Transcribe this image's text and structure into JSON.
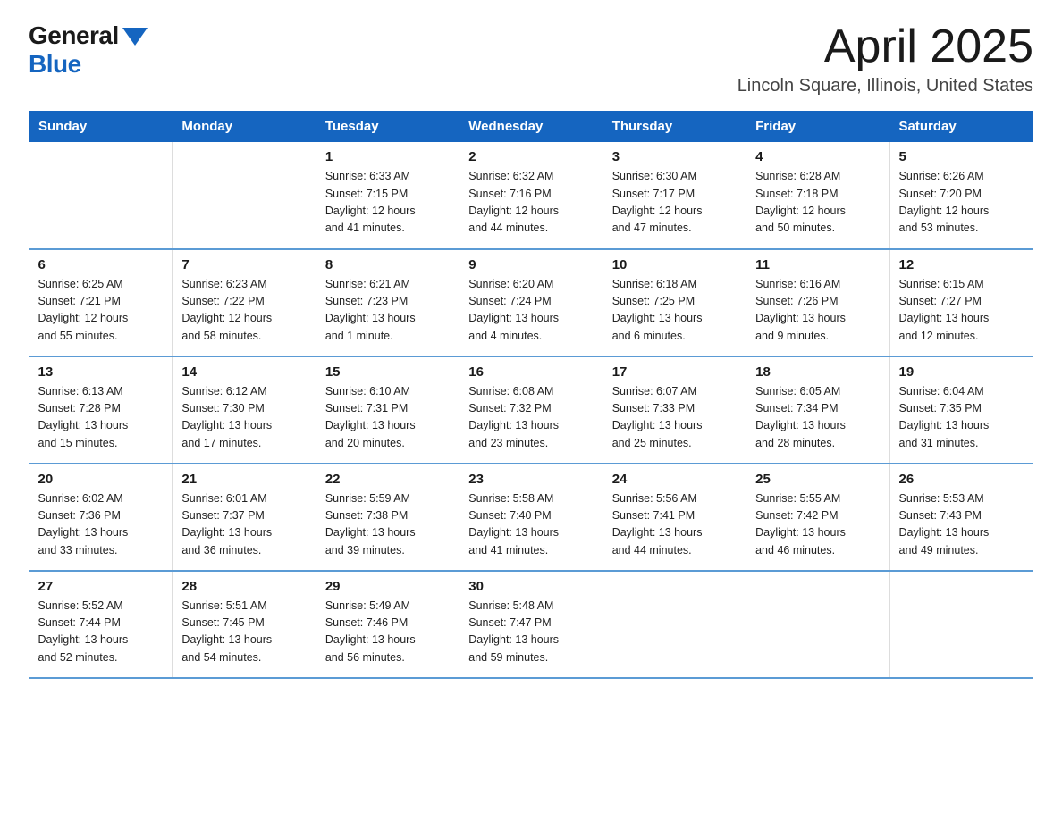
{
  "header": {
    "logo_general": "General",
    "logo_blue": "Blue",
    "title": "April 2025",
    "subtitle": "Lincoln Square, Illinois, United States"
  },
  "days_of_week": [
    "Sunday",
    "Monday",
    "Tuesday",
    "Wednesday",
    "Thursday",
    "Friday",
    "Saturday"
  ],
  "weeks": [
    [
      {
        "day": "",
        "info": ""
      },
      {
        "day": "",
        "info": ""
      },
      {
        "day": "1",
        "info": "Sunrise: 6:33 AM\nSunset: 7:15 PM\nDaylight: 12 hours\nand 41 minutes."
      },
      {
        "day": "2",
        "info": "Sunrise: 6:32 AM\nSunset: 7:16 PM\nDaylight: 12 hours\nand 44 minutes."
      },
      {
        "day": "3",
        "info": "Sunrise: 6:30 AM\nSunset: 7:17 PM\nDaylight: 12 hours\nand 47 minutes."
      },
      {
        "day": "4",
        "info": "Sunrise: 6:28 AM\nSunset: 7:18 PM\nDaylight: 12 hours\nand 50 minutes."
      },
      {
        "day": "5",
        "info": "Sunrise: 6:26 AM\nSunset: 7:20 PM\nDaylight: 12 hours\nand 53 minutes."
      }
    ],
    [
      {
        "day": "6",
        "info": "Sunrise: 6:25 AM\nSunset: 7:21 PM\nDaylight: 12 hours\nand 55 minutes."
      },
      {
        "day": "7",
        "info": "Sunrise: 6:23 AM\nSunset: 7:22 PM\nDaylight: 12 hours\nand 58 minutes."
      },
      {
        "day": "8",
        "info": "Sunrise: 6:21 AM\nSunset: 7:23 PM\nDaylight: 13 hours\nand 1 minute."
      },
      {
        "day": "9",
        "info": "Sunrise: 6:20 AM\nSunset: 7:24 PM\nDaylight: 13 hours\nand 4 minutes."
      },
      {
        "day": "10",
        "info": "Sunrise: 6:18 AM\nSunset: 7:25 PM\nDaylight: 13 hours\nand 6 minutes."
      },
      {
        "day": "11",
        "info": "Sunrise: 6:16 AM\nSunset: 7:26 PM\nDaylight: 13 hours\nand 9 minutes."
      },
      {
        "day": "12",
        "info": "Sunrise: 6:15 AM\nSunset: 7:27 PM\nDaylight: 13 hours\nand 12 minutes."
      }
    ],
    [
      {
        "day": "13",
        "info": "Sunrise: 6:13 AM\nSunset: 7:28 PM\nDaylight: 13 hours\nand 15 minutes."
      },
      {
        "day": "14",
        "info": "Sunrise: 6:12 AM\nSunset: 7:30 PM\nDaylight: 13 hours\nand 17 minutes."
      },
      {
        "day": "15",
        "info": "Sunrise: 6:10 AM\nSunset: 7:31 PM\nDaylight: 13 hours\nand 20 minutes."
      },
      {
        "day": "16",
        "info": "Sunrise: 6:08 AM\nSunset: 7:32 PM\nDaylight: 13 hours\nand 23 minutes."
      },
      {
        "day": "17",
        "info": "Sunrise: 6:07 AM\nSunset: 7:33 PM\nDaylight: 13 hours\nand 25 minutes."
      },
      {
        "day": "18",
        "info": "Sunrise: 6:05 AM\nSunset: 7:34 PM\nDaylight: 13 hours\nand 28 minutes."
      },
      {
        "day": "19",
        "info": "Sunrise: 6:04 AM\nSunset: 7:35 PM\nDaylight: 13 hours\nand 31 minutes."
      }
    ],
    [
      {
        "day": "20",
        "info": "Sunrise: 6:02 AM\nSunset: 7:36 PM\nDaylight: 13 hours\nand 33 minutes."
      },
      {
        "day": "21",
        "info": "Sunrise: 6:01 AM\nSunset: 7:37 PM\nDaylight: 13 hours\nand 36 minutes."
      },
      {
        "day": "22",
        "info": "Sunrise: 5:59 AM\nSunset: 7:38 PM\nDaylight: 13 hours\nand 39 minutes."
      },
      {
        "day": "23",
        "info": "Sunrise: 5:58 AM\nSunset: 7:40 PM\nDaylight: 13 hours\nand 41 minutes."
      },
      {
        "day": "24",
        "info": "Sunrise: 5:56 AM\nSunset: 7:41 PM\nDaylight: 13 hours\nand 44 minutes."
      },
      {
        "day": "25",
        "info": "Sunrise: 5:55 AM\nSunset: 7:42 PM\nDaylight: 13 hours\nand 46 minutes."
      },
      {
        "day": "26",
        "info": "Sunrise: 5:53 AM\nSunset: 7:43 PM\nDaylight: 13 hours\nand 49 minutes."
      }
    ],
    [
      {
        "day": "27",
        "info": "Sunrise: 5:52 AM\nSunset: 7:44 PM\nDaylight: 13 hours\nand 52 minutes."
      },
      {
        "day": "28",
        "info": "Sunrise: 5:51 AM\nSunset: 7:45 PM\nDaylight: 13 hours\nand 54 minutes."
      },
      {
        "day": "29",
        "info": "Sunrise: 5:49 AM\nSunset: 7:46 PM\nDaylight: 13 hours\nand 56 minutes."
      },
      {
        "day": "30",
        "info": "Sunrise: 5:48 AM\nSunset: 7:47 PM\nDaylight: 13 hours\nand 59 minutes."
      },
      {
        "day": "",
        "info": ""
      },
      {
        "day": "",
        "info": ""
      },
      {
        "day": "",
        "info": ""
      }
    ]
  ]
}
